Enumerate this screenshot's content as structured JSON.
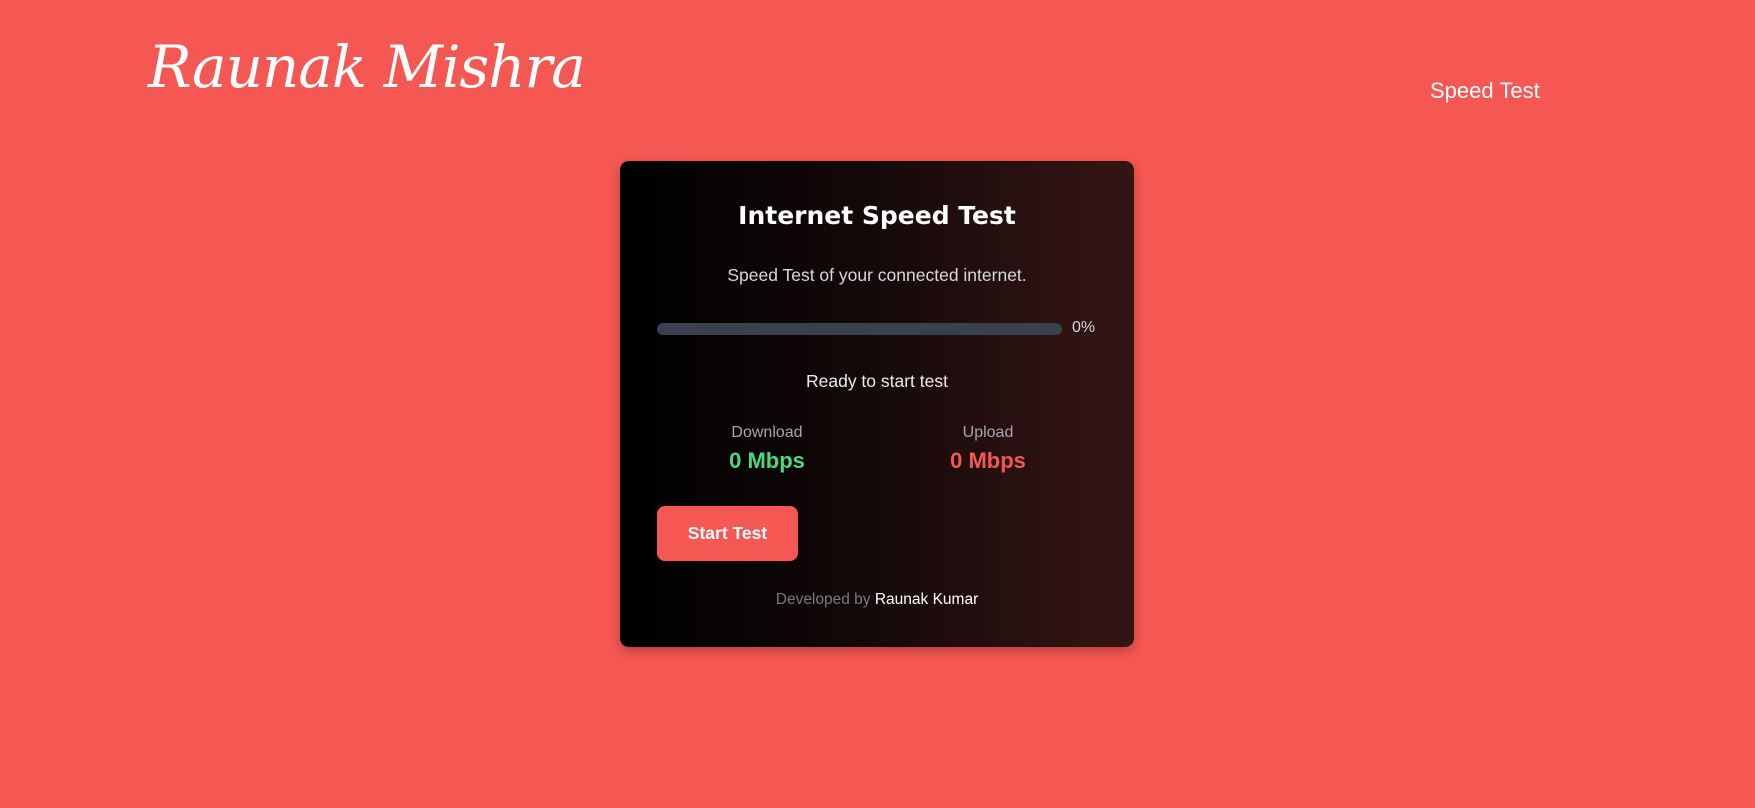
{
  "header": {
    "brand": "Raunak Mishra",
    "nav": [
      {
        "label": "Speed Test"
      }
    ]
  },
  "card": {
    "title": "Internet Speed Test",
    "subtitle": "Speed Test of your connected internet.",
    "progress": {
      "value": 0,
      "label": "0%"
    },
    "status": "Ready to start test",
    "download": {
      "label": "Download",
      "value": "0 Mbps"
    },
    "upload": {
      "label": "Upload",
      "value": "0 Mbps"
    },
    "start_button": "Start Test",
    "footer": {
      "prefix": "Developed by",
      "author": "Raunak Kumar"
    }
  },
  "colors": {
    "background": "#f55753",
    "download": "#4ed87c",
    "upload": "#f55753",
    "progress_track": "#394150"
  }
}
